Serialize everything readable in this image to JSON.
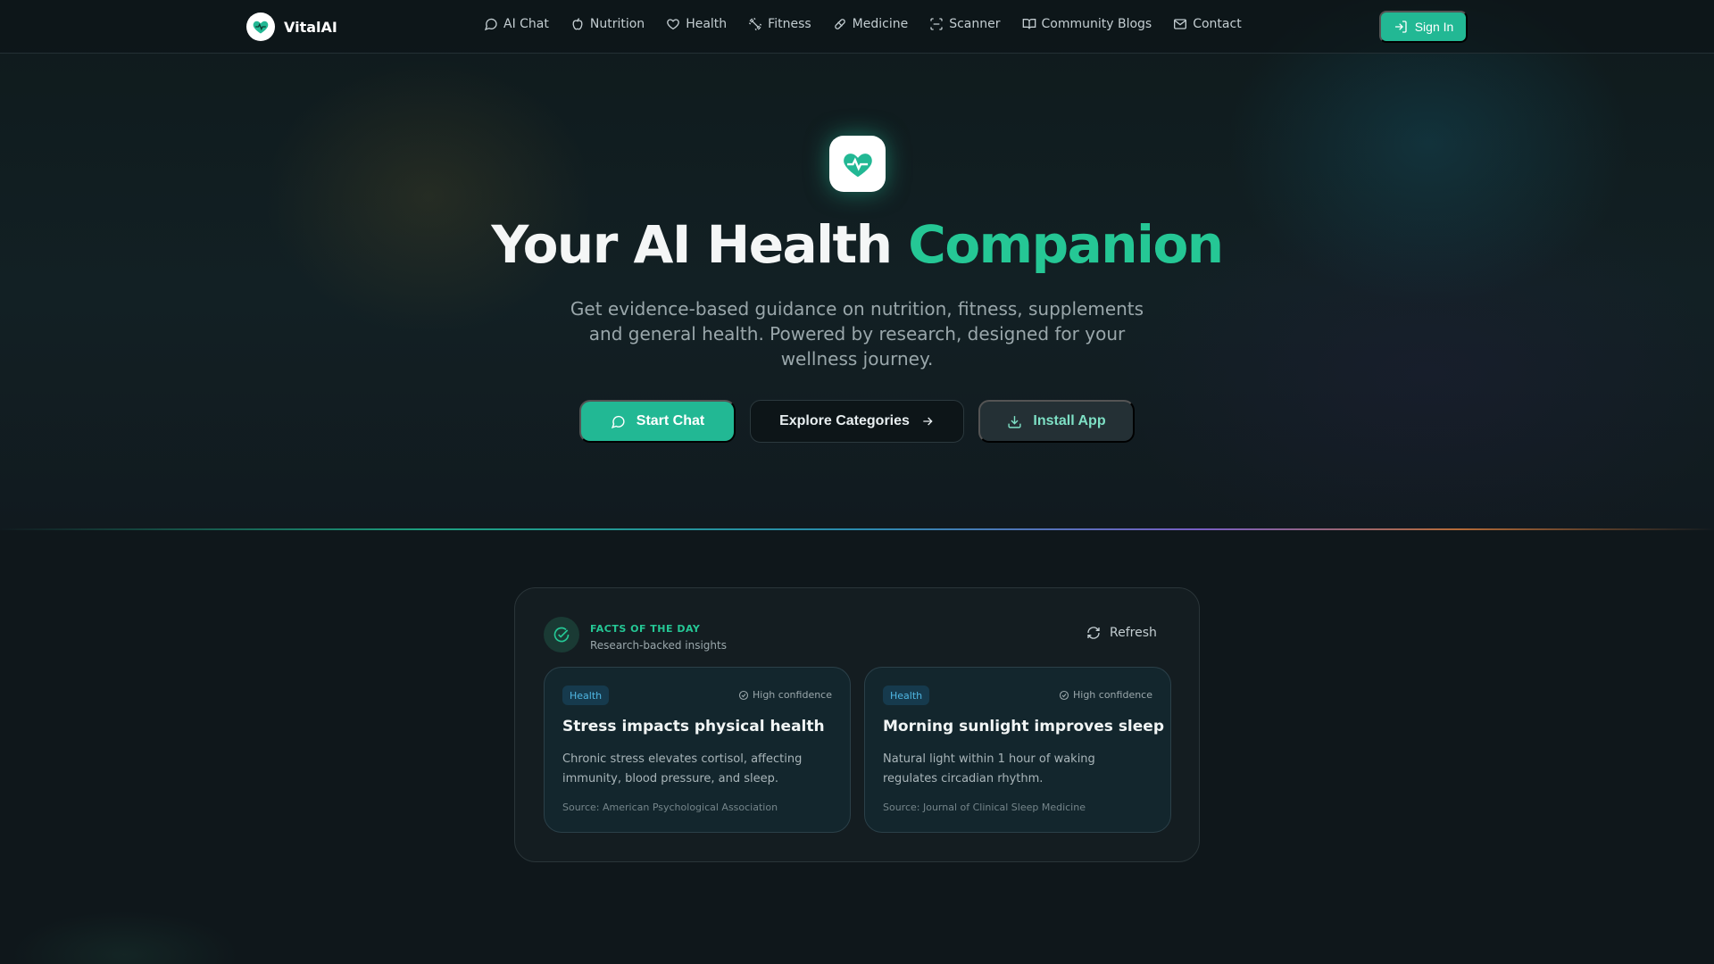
{
  "brand": {
    "name": "VitalAI"
  },
  "nav": {
    "links": [
      {
        "label": "AI Chat",
        "icon": "chat-bubble-icon"
      },
      {
        "label": "Nutrition",
        "icon": "apple-icon"
      },
      {
        "label": "Health",
        "icon": "heart-icon"
      },
      {
        "label": "Fitness",
        "icon": "dumbbell-icon"
      },
      {
        "label": "Medicine",
        "icon": "pill-icon"
      },
      {
        "label": "Scanner",
        "icon": "scan-icon"
      },
      {
        "label": "Community Blogs",
        "icon": "book-icon"
      },
      {
        "label": "Contact",
        "icon": "mail-icon"
      }
    ],
    "sign_in": "Sign In"
  },
  "hero": {
    "title_main": "Your AI Health ",
    "title_accent": "Companion",
    "subtitle": "Get evidence-based guidance on nutrition, fitness, supplements and general health. Powered by research, designed for your wellness journey.",
    "buttons": {
      "start_chat": "Start Chat",
      "explore": "Explore Categories",
      "install": "Install App"
    }
  },
  "facts": {
    "title": "FACTS OF THE DAY",
    "subtitle": "Research-backed insights",
    "refresh": "Refresh",
    "cards": [
      {
        "tag": "Health",
        "confidence": "High confidence",
        "title": "Stress impacts physical health",
        "body": "Chronic stress elevates cortisol, affecting immunity, blood pressure, and sleep.",
        "source": "Source: American Psychological Association"
      },
      {
        "tag": "Health",
        "confidence": "High confidence",
        "title": "Morning sunlight improves sleep",
        "body": "Natural light within 1 hour of waking regulates circadian rhythm.",
        "source": "Source: Journal of Clinical Sleep Medicine"
      }
    ]
  },
  "colors": {
    "accent": "#22b894",
    "accent_text": "#25c795",
    "background": "#0f171b",
    "tag": "#4fb6e3"
  }
}
